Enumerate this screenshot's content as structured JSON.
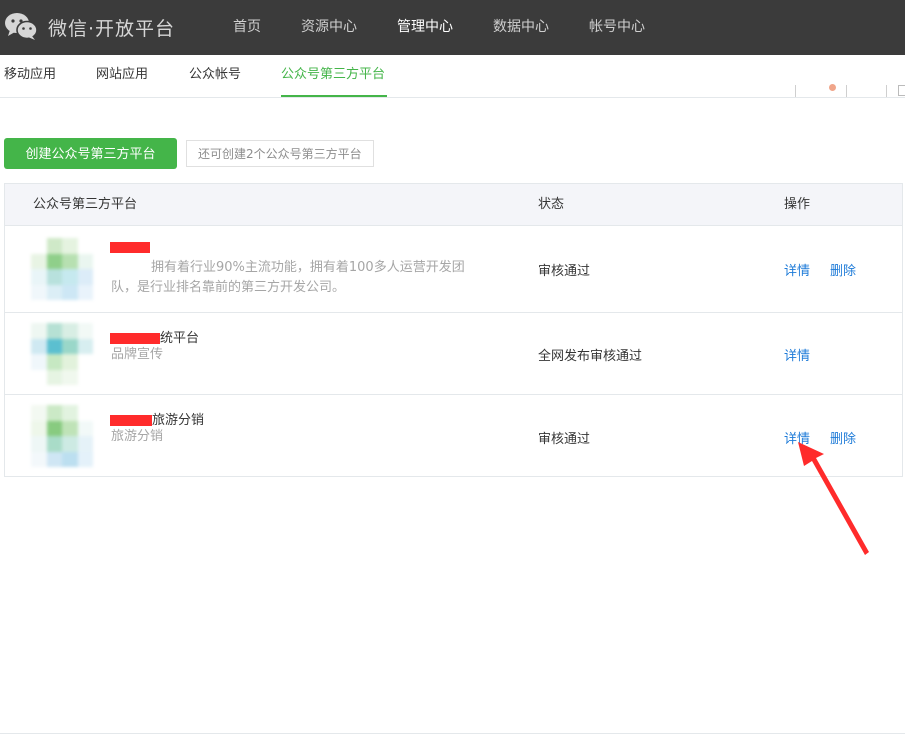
{
  "header": {
    "brand": "微信·开放平台",
    "nav": [
      {
        "label": "首页"
      },
      {
        "label": "资源中心"
      },
      {
        "label": "管理中心"
      },
      {
        "label": "数据中心"
      },
      {
        "label": "帐号中心"
      }
    ],
    "active_nav": "管理中心"
  },
  "subtabs": [
    {
      "label": "移动应用"
    },
    {
      "label": "网站应用"
    },
    {
      "label": "公众帐号"
    },
    {
      "label": "公众号第三方平台"
    }
  ],
  "active_subtab": "公众号第三方平台",
  "toolbar": {
    "create_label": "创建公众号第三方平台",
    "quota_tip": "还可创建2个公众号第三方平台"
  },
  "table": {
    "headers": {
      "platform": "公众号第三方平台",
      "status": "状态",
      "actions": "操作"
    },
    "rows": [
      {
        "name_suffix": "",
        "desc": "拥有着行业90%主流功能，拥有着100多人运营开发团队，是行业排名靠前的第三方开发公司。",
        "status": "审核通过",
        "detail_label": "详情",
        "delete_label": "删除"
      },
      {
        "name_suffix": "统平台",
        "desc": "品牌宣传",
        "status": "全网发布审核通过",
        "detail_label": "详情",
        "delete_label": ""
      },
      {
        "name_suffix": "旅游分销",
        "desc": "旅游分销",
        "status": "审核通过",
        "detail_label": "详情",
        "delete_label": "删除"
      }
    ]
  },
  "colors": {
    "accent": "#44b549",
    "link": "#1e7bd8",
    "nav_bg": "#3b3b3b",
    "annotation_arrow": "#ff2b2b"
  },
  "icons": [
    "wechat-logo-icon",
    "annotation-arrow-icon"
  ]
}
